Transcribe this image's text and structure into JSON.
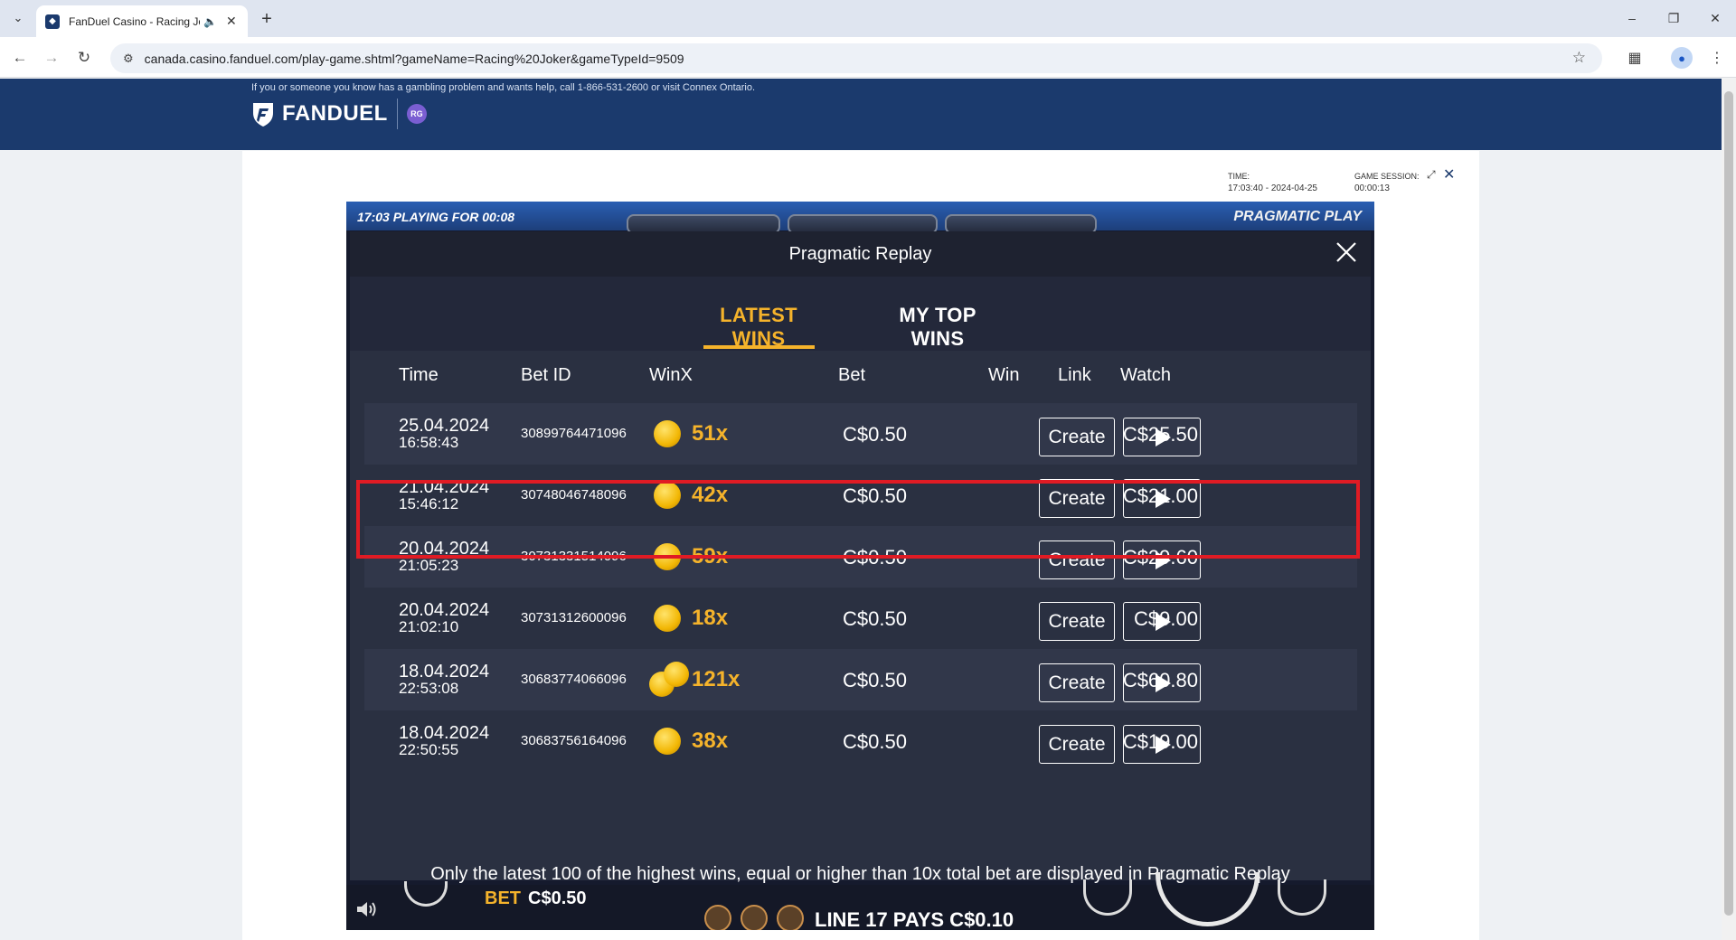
{
  "browser": {
    "tab_title": "FanDuel Casino - Racing Joker",
    "url": "canada.casino.fanduel.com/play-game.shtml?gameName=Racing%20Joker&gameTypeId=9509"
  },
  "header": {
    "rg_notice": "If you or someone you know has a gambling problem and wants help, call 1-866-531-2600 or visit Connex Ontario.",
    "logo_text": "FANDUEL",
    "rg_badge": "RG"
  },
  "session": {
    "time_label": "TIME:",
    "time_value": "17:03:40 - 2024-04-25",
    "game_label": "GAME SESSION:",
    "game_value": "00:00:13"
  },
  "game": {
    "clock": "17:03  PLAYING FOR 00:08",
    "provider": "PRAGMATIC PLAY",
    "footer_note": "Only the latest 100 of the highest wins, equal or higher than 10x total bet are displayed in Pragmatic Replay",
    "bet_label": "BET",
    "bet_value": "C$0.50",
    "line_pays": "LINE 17 PAYS C$0.10"
  },
  "replay": {
    "title": "Pragmatic Replay",
    "tabs": [
      "LATEST WINS",
      "MY TOP WINS"
    ],
    "active_tab": "LATEST WINS",
    "columns": {
      "time": "Time",
      "bet_id": "Bet ID",
      "winx": "WinX",
      "bet": "Bet",
      "win": "Win",
      "link": "Link",
      "watch": "Watch"
    },
    "create_label": "Create",
    "rows": [
      {
        "date": "25.04.2024",
        "time": "16:58:43",
        "bet_id": "30899764471096",
        "winx": "51x",
        "bet": "C$0.50",
        "win": "C$25.50"
      },
      {
        "date": "21.04.2024",
        "time": "15:46:12",
        "bet_id": "30748046748096",
        "winx": "42x",
        "bet": "C$0.50",
        "win": "C$21.00"
      },
      {
        "date": "20.04.2024",
        "time": "21:05:23",
        "bet_id": "30731331514096",
        "winx": "59x",
        "bet": "C$0.50",
        "win": "C$29.60"
      },
      {
        "date": "20.04.2024",
        "time": "21:02:10",
        "bet_id": "30731312600096",
        "winx": "18x",
        "bet": "C$0.50",
        "win": "C$9.00"
      },
      {
        "date": "18.04.2024",
        "time": "22:53:08",
        "bet_id": "30683774066096",
        "winx": "121x",
        "bet": "C$0.50",
        "win": "C$60.80"
      },
      {
        "date": "18.04.2024",
        "time": "22:50:55",
        "bet_id": "30683756164096",
        "winx": "38x",
        "bet": "C$0.50",
        "win": "C$19.00"
      }
    ]
  },
  "colors": {
    "brand_navy": "#1b3a6d",
    "accent_gold": "#f5b32b",
    "highlight_red": "#e01b24"
  }
}
